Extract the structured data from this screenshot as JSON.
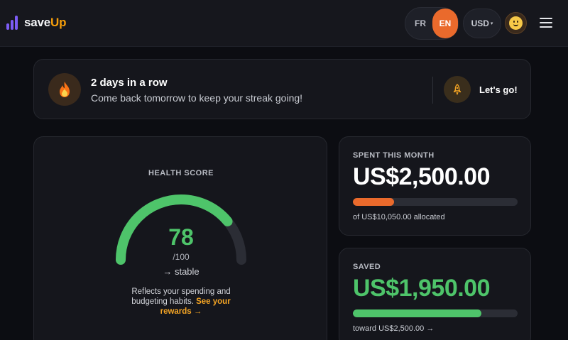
{
  "header": {
    "logo": {
      "part1": "save",
      "part2": "Up"
    },
    "languages": [
      "FR",
      "EN"
    ],
    "active_language": "EN",
    "currency": "USD",
    "avatar_icon": "smiley-face-icon",
    "menu_icon": "hamburger-menu-icon"
  },
  "streak": {
    "icon": "fire-icon",
    "title": "2 days in a row",
    "subtitle": "Come back tomorrow to keep your streak going!",
    "cta_icon": "rocket-icon",
    "cta_label": "Let's go!"
  },
  "health": {
    "label": "HEALTH SCORE",
    "score": "78",
    "max": "/100",
    "score_fraction": 0.78,
    "trend": "→ stable",
    "description": "Reflects your spending and budgeting habits.",
    "link": "See your rewards →"
  },
  "spent": {
    "label": "SPENT THIS MONTH",
    "value": "US$2,500.00",
    "note": "of US$10,050.00 allocated",
    "progress": 0.25
  },
  "saved": {
    "label": "SAVED",
    "value": "US$1,950.00",
    "note": "toward US$2,500.00 →",
    "progress": 0.78
  },
  "colors": {
    "accent_orange": "#ea6a2c",
    "accent_green": "#4ec46a",
    "brand_purple": "#7c5cf5",
    "link_amber": "#f5a524"
  }
}
